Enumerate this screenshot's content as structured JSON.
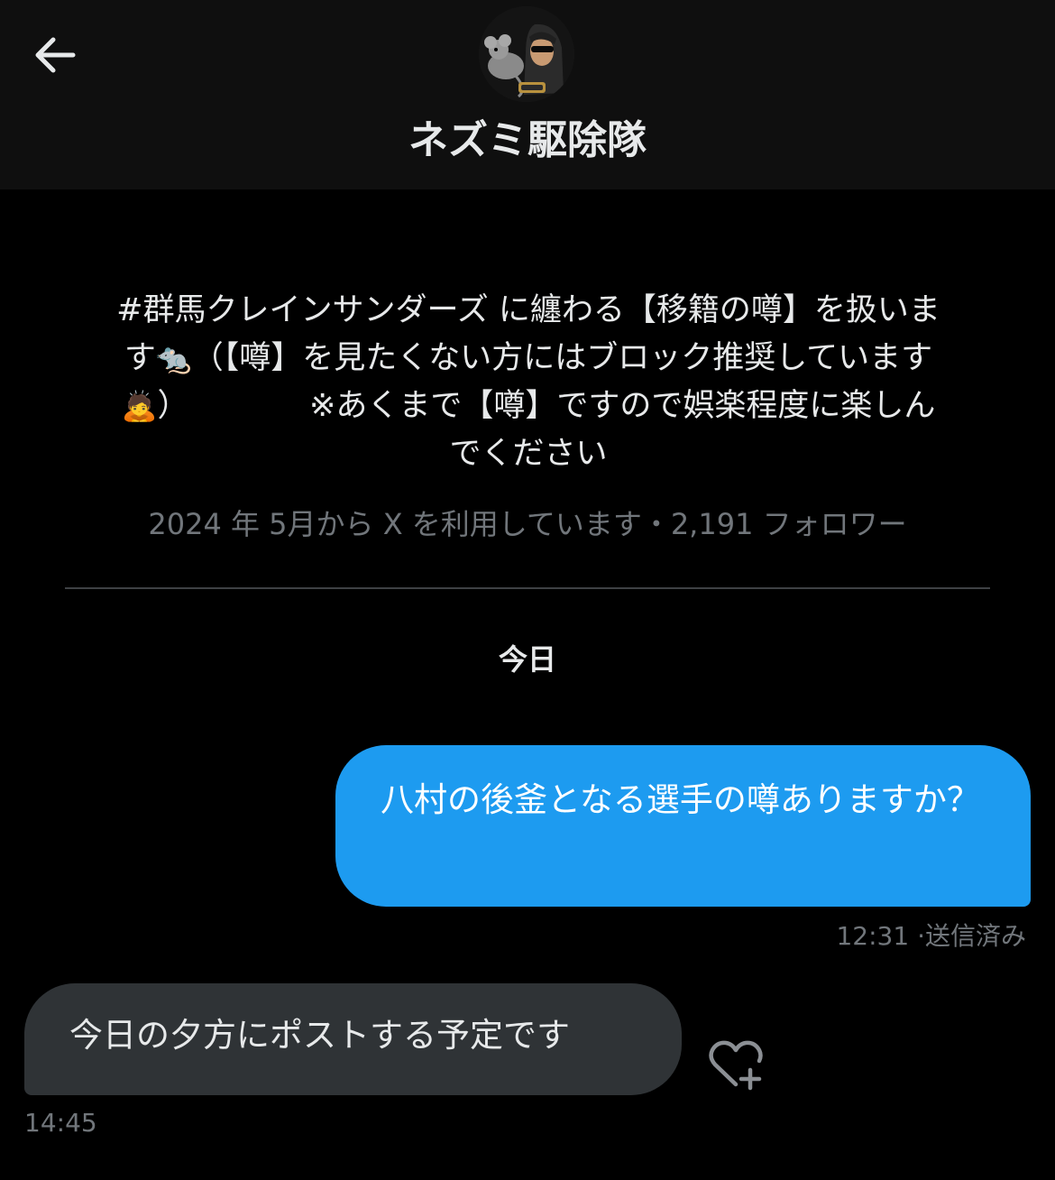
{
  "header": {
    "back_icon": "arrow-left-icon",
    "avatar_icon": "profile-avatar-rat-icon",
    "title": "ネズミ駆除隊"
  },
  "profile": {
    "bio_line1": "#群馬クレインサンダーズ に纏わる【移籍の噂】を扱いま",
    "bio_line2_a": "す",
    "bio_line2_b": "（【噂】を見たくない方にはブロック推奨しています",
    "bio_line3_a": "）",
    "bio_line3_b": "※あくまで【噂】ですので娯楽程度に楽しん",
    "bio_line4": "でください",
    "rat_emoji": "🐀",
    "bow_emoji": "🙇",
    "meta": "2024 年 5月から X を利用しています・2,191 フォロワー"
  },
  "conversation": {
    "date_label": "今日",
    "messages": [
      {
        "direction": "outgoing",
        "text": "八村の後釜となる選手の噂ありますか？",
        "time": "12:31",
        "status": "·送信済み"
      },
      {
        "direction": "incoming",
        "text": "今日の夕方にポストする予定です",
        "time": "14:45",
        "reaction_icon": "add-reaction-heart-icon"
      }
    ]
  },
  "colors": {
    "background": "#000000",
    "header_background": "#0f0f0f",
    "outgoing_bubble": "#1d9bf0",
    "incoming_bubble": "#2f3336",
    "secondary_text": "#71767b",
    "primary_text": "#e7e9ea"
  }
}
